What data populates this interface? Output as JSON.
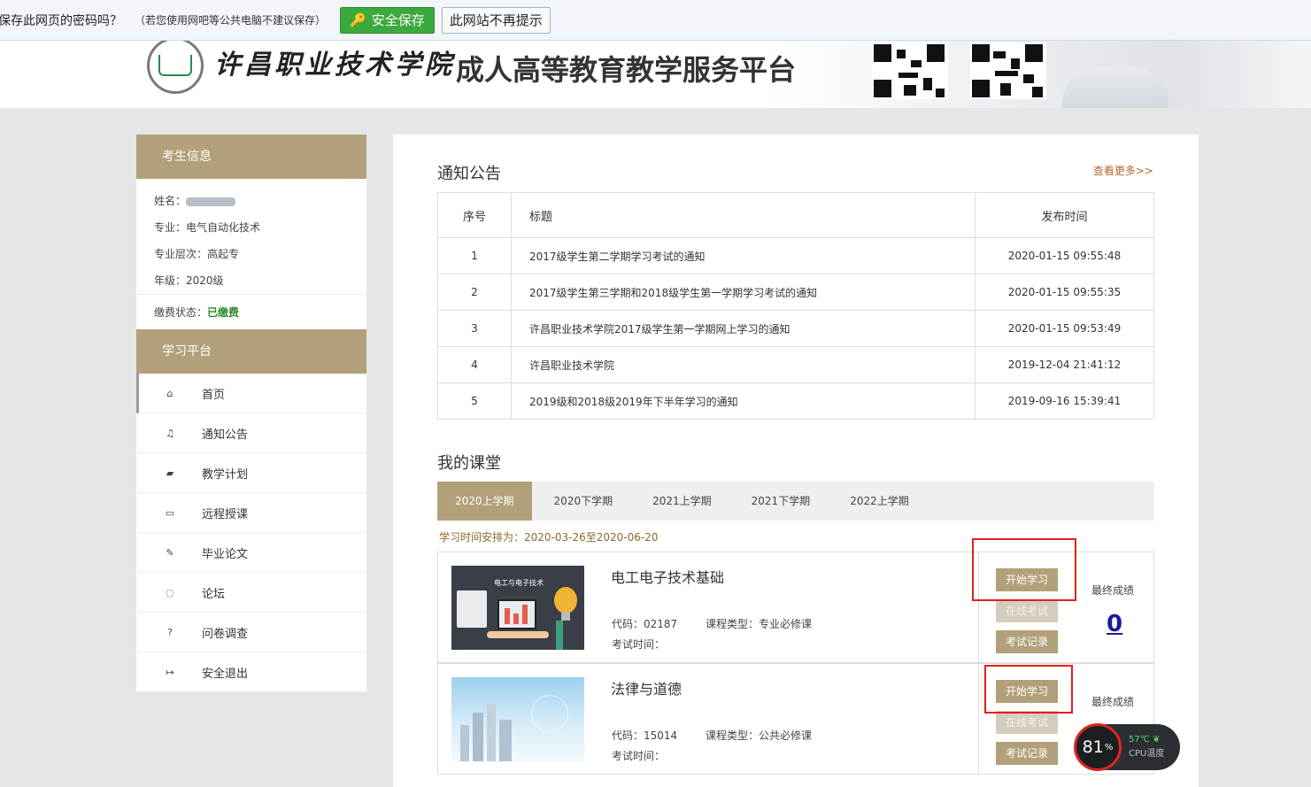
{
  "password_bar": {
    "question": "保存此网页的密码吗？",
    "hint": "（若您使用网吧等公共电脑不建议保存）",
    "save_button": "安全保存",
    "never_button": "此网站不再提示"
  },
  "header": {
    "school_name": "许昌职业技术学院",
    "platform_title": "成人高等教育教学服务平台"
  },
  "student_info": {
    "heading": "考生信息",
    "name_label": "姓名：",
    "major": "专业：电气自动化技术",
    "level": "专业层次：高起专",
    "grade": "年级：2020级",
    "payment_label": "缴费状态：",
    "payment_value": "已缴费"
  },
  "platform_menu": {
    "heading": "学习平台",
    "items": [
      {
        "label": "首页",
        "icon": "home-icon"
      },
      {
        "label": "通知公告",
        "icon": "bell-icon"
      },
      {
        "label": "教学计划",
        "icon": "book-icon"
      },
      {
        "label": "远程授课",
        "icon": "monitor-icon"
      },
      {
        "label": "毕业论文",
        "icon": "edit-icon"
      },
      {
        "label": "论坛",
        "icon": "comment-icon"
      },
      {
        "label": "问卷调查",
        "icon": "question-icon"
      },
      {
        "label": "安全退出",
        "icon": "logout-icon"
      }
    ]
  },
  "notices": {
    "title": "通知公告",
    "more": "查看更多>>",
    "columns": [
      "序号",
      "标题",
      "发布时间"
    ],
    "rows": [
      {
        "no": "1",
        "title": "2017级学生第二学期学习考试的通知",
        "time": "2020-01-15 09:55:48"
      },
      {
        "no": "2",
        "title": "2017级学生第三学期和2018级学生第一学期学习考试的通知",
        "time": "2020-01-15 09:55:35"
      },
      {
        "no": "3",
        "title": "许昌职业技术学院2017级学生第一学期网上学习的通知",
        "time": "2020-01-15 09:53:49"
      },
      {
        "no": "4",
        "title": "许昌职业技术学院",
        "time": "2019-12-04 21:41:12"
      },
      {
        "no": "5",
        "title": "2019级和2018级2019年下半年学习的通知",
        "time": "2019-09-16 15:39:41"
      }
    ]
  },
  "classroom": {
    "title": "我的课堂",
    "tabs": [
      "2020上学期",
      "2020下学期",
      "2021上学期",
      "2021下学期",
      "2022上学期"
    ],
    "schedule": "学习时间安排为：2020-03-26至2020-06-20",
    "courses": [
      {
        "name": "电工电子技术基础",
        "thumb_caption": "电工与电子技术",
        "code": "代码：02187",
        "type": "课程类型：专业必修课",
        "exam_time": "考试时间：",
        "btn_study": "开始学习",
        "btn_exam": "在线考试",
        "btn_record": "考试记录",
        "score_label": "最终成绩",
        "score": "0"
      },
      {
        "name": "法律与道德",
        "code": "代码：15014",
        "type": "课程类型：公共必修课",
        "exam_time": "考试时间：",
        "btn_study": "开始学习",
        "btn_exam": "在线考试",
        "btn_record": "考试记录",
        "score_label": "最终成绩"
      }
    ]
  },
  "cpu_widget": {
    "percent": "81",
    "percent_unit": "%",
    "temperature": "57℃",
    "label": "CPU温度"
  },
  "colors": {
    "accent": "#b1a07a",
    "highlight_box": "#e02020",
    "paid": "#2e8a2e"
  }
}
